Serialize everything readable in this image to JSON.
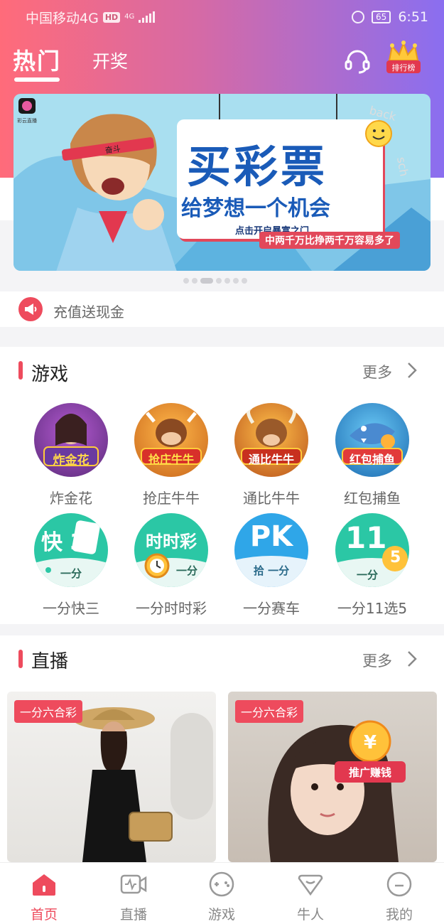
{
  "status_bar": {
    "carrier": "中国移动4G",
    "hd": "HD",
    "network": "4G",
    "battery": "65",
    "time": "6:51"
  },
  "top_nav": {
    "tabs": [
      {
        "label": "热门",
        "active": true
      },
      {
        "label": "开奖",
        "active": false
      }
    ],
    "ranking_label": "排行榜"
  },
  "banner": {
    "app_label": "彩云直播",
    "headband_text": "奋斗",
    "title": "买彩票",
    "subtitle": "给梦想一个机会",
    "small_text": "点击开启暴富之门",
    "red_text": "中两千万比挣两千万容易多了",
    "sign_text_1": "back",
    "sign_text_2": "sch",
    "page_count": 7,
    "active_page": 3
  },
  "notice": {
    "text": "充值送现金"
  },
  "games": {
    "title": "游戏",
    "more": "更多",
    "items": [
      {
        "label": "炸金花",
        "icon_text": "炸金花",
        "color": "#7a3f9a"
      },
      {
        "label": "抢庄牛牛",
        "icon_text": "抢庄牛牛",
        "color": "#e0912a"
      },
      {
        "label": "通比牛牛",
        "icon_text": "通比牛牛",
        "color": "#d9752a"
      },
      {
        "label": "红包捕鱼",
        "icon_text": "红包捕鱼",
        "color": "#2e8fd6"
      },
      {
        "label": "一分快三",
        "icon_text": "快 3",
        "sub": "一分",
        "color": "#2bc7a5"
      },
      {
        "label": "一分时时彩",
        "icon_text": "时时彩",
        "sub": "一分",
        "color": "#2bc7a5"
      },
      {
        "label": "一分赛车",
        "icon_text": "PK",
        "sub": "拾 一分",
        "color": "#2fa6e8"
      },
      {
        "label": "一分11选5",
        "icon_text": "11",
        "sub": "一分",
        "badge": "5",
        "color": "#2bc7a5"
      }
    ]
  },
  "live": {
    "title": "直播",
    "more": "更多",
    "cards": [
      {
        "tag": "一分六合彩"
      },
      {
        "tag": "一分六合彩",
        "promo": "推广赚钱",
        "promo_coin": "¥"
      }
    ]
  },
  "tabbar": {
    "items": [
      {
        "label": "首页",
        "active": true
      },
      {
        "label": "直播",
        "active": false
      },
      {
        "label": "游戏",
        "active": false
      },
      {
        "label": "牛人",
        "active": false
      },
      {
        "label": "我的",
        "active": false
      }
    ]
  },
  "colors": {
    "accent": "#ee4b5d",
    "gradient_start": "#ff6b7a",
    "gradient_end": "#8a6ef0",
    "banner_blue": "#1a5bb8"
  }
}
